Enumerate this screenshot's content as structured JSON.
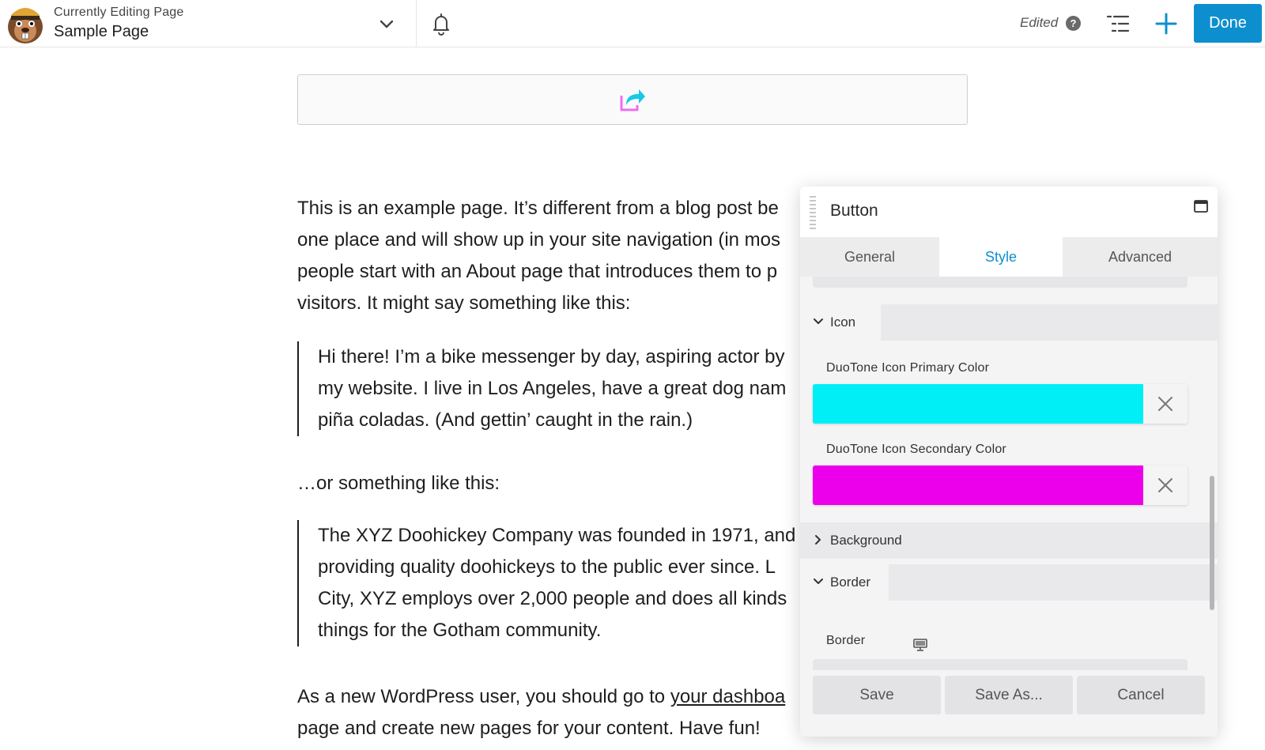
{
  "topbar": {
    "context_label": "Currently Editing Page",
    "page_name": "Sample Page",
    "status": "Edited",
    "help_glyph": "?",
    "done_label": "Done",
    "accent_color": "#0d8fcf"
  },
  "content": {
    "paragraph1": [
      "This is an example page. It’s different from a blog post be",
      "one place and will show up in your site navigation (in mos",
      "people start with an About page that introduces them to p",
      "visitors. It might say something like this:"
    ],
    "quote1": [
      "Hi there! I’m a bike messenger by day, aspiring actor by",
      "my website. I live in Los Angeles, have a great dog nam",
      "piña coladas. (And gettin’ caught in the rain.)"
    ],
    "paragraph2": "…or something like this:",
    "quote2": [
      "The XYZ Doohickey Company was founded in 1971, and",
      "providing quality doohickeys to the public ever since. L",
      "City, XYZ employs over 2,000 people and does all kinds",
      "things for the Gotham community."
    ],
    "paragraph3_prefix": "As a new WordPress user, you should go to ",
    "paragraph3_link": "your dashboa",
    "paragraph3_line2": "page and create new pages for your content. Have fun!"
  },
  "panel": {
    "title": "Button",
    "tabs": [
      "General",
      "Style",
      "Advanced"
    ],
    "active_tab": "Style",
    "sections": {
      "icon": "Icon",
      "background": "Background",
      "border": "Border"
    },
    "fields": {
      "primary_label": "DuoTone Icon Primary Color",
      "primary_color": "#00eff6",
      "secondary_label": "DuoTone Icon Secondary Color",
      "secondary_color": "#ec00ec",
      "border_label": "Border"
    },
    "footer": {
      "save": "Save",
      "save_as": "Save As...",
      "cancel": "Cancel"
    }
  }
}
